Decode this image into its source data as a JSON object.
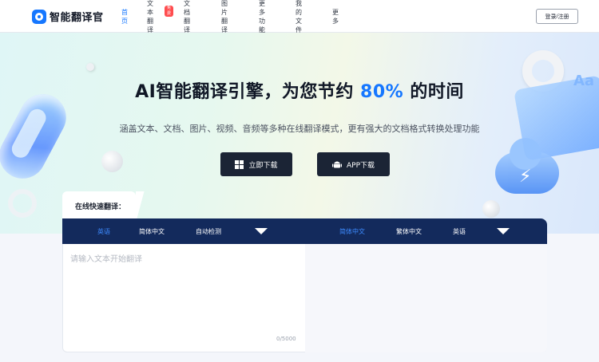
{
  "brand": {
    "name": "智能翻译官"
  },
  "nav": {
    "items": [
      {
        "label": "首页",
        "active": true
      },
      {
        "label": "文本翻译",
        "badge": "免费"
      },
      {
        "label": "文档翻译"
      },
      {
        "label": "图片翻译"
      },
      {
        "label": "更多功能"
      },
      {
        "label": "我的文件"
      },
      {
        "label": "更多"
      }
    ]
  },
  "header": {
    "login_label": "登录/注册"
  },
  "hero": {
    "title_prefix": "AI智能翻译引擎，为您节约",
    "title_highlight": "80%",
    "title_suffix": "的时间",
    "subtitle": "涵盖文本、文档、图片、视频、音频等多种在线翻译模式，更有强大的文档格式转换处理功能",
    "download_label": "立即下载",
    "app_label": "APP下载",
    "deco_text": "Aa"
  },
  "translator": {
    "quick_label": "在线快速翻译：",
    "source_langs": [
      "英语",
      "简体中文",
      "自动检测"
    ],
    "target_langs": [
      "简体中文",
      "繁体中文",
      "英语"
    ],
    "input_placeholder": "请输入文本开始翻译",
    "char_count": "0/5000"
  },
  "colors": {
    "accent": "#1677ff",
    "lang_bar": "#132a5c",
    "button_dark": "#1b2435",
    "badge": "#ff4d4f"
  },
  "icons": {
    "logo": "translate-logo-icon",
    "windows": "windows-icon",
    "android": "android-icon",
    "dropdown": "chevron-down-icon"
  }
}
